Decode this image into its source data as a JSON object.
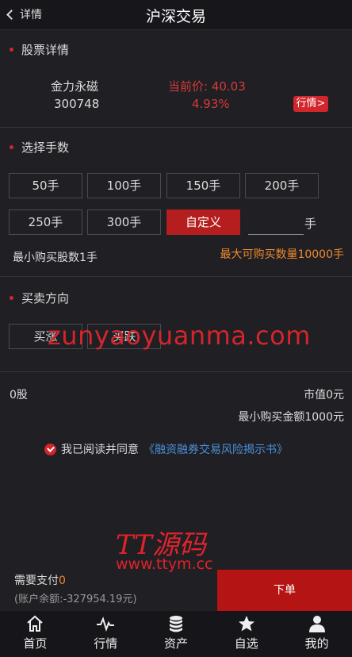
{
  "header": {
    "back_label": "详情",
    "title": "沪深交易"
  },
  "stock_section": {
    "title": "股票详情",
    "name": "金力永磁",
    "code": "300748",
    "price_label": "当前价: 40.03",
    "change_pct": "4.93%",
    "quote_button": "行情>"
  },
  "lots_section": {
    "title": "选择手数",
    "options": [
      "50手",
      "100手",
      "150手",
      "200手",
      "250手",
      "300手",
      "自定义"
    ],
    "custom_value": "",
    "unit": "手",
    "min_lot": "最小购买股数1手",
    "max_lot": "最大可购买数量10000手"
  },
  "direction_section": {
    "title": "买卖方向",
    "buy_up": "买涨",
    "buy_down": "买跌"
  },
  "watermark_site": "zunyaoyuanma.com",
  "summary": {
    "shares": "0股",
    "market_value": "市值0元",
    "min_amount": "最小购买金额1000元"
  },
  "agreement": {
    "text": "我已阅读并同意",
    "link": "《融资融券交易风险揭示书》"
  },
  "watermark_brand": {
    "logo": "TT源码",
    "url": "www.ttym.cc"
  },
  "footer": {
    "pay_label": "需要支付",
    "pay_amount": "0",
    "balance": "(账户余额:-327954.19元)",
    "order_button": "下单"
  },
  "tabbar": {
    "items": [
      {
        "label": "首页",
        "icon": "home-icon"
      },
      {
        "label": "行情",
        "icon": "pulse-icon"
      },
      {
        "label": "资产",
        "icon": "coins-icon"
      },
      {
        "label": "自选",
        "icon": "star-icon"
      },
      {
        "label": "我的",
        "icon": "user-icon"
      }
    ]
  },
  "colors": {
    "accent": "#d2262c",
    "orange": "#ef8a2c",
    "link": "#4b8fd6",
    "background": "#1f1f24"
  }
}
